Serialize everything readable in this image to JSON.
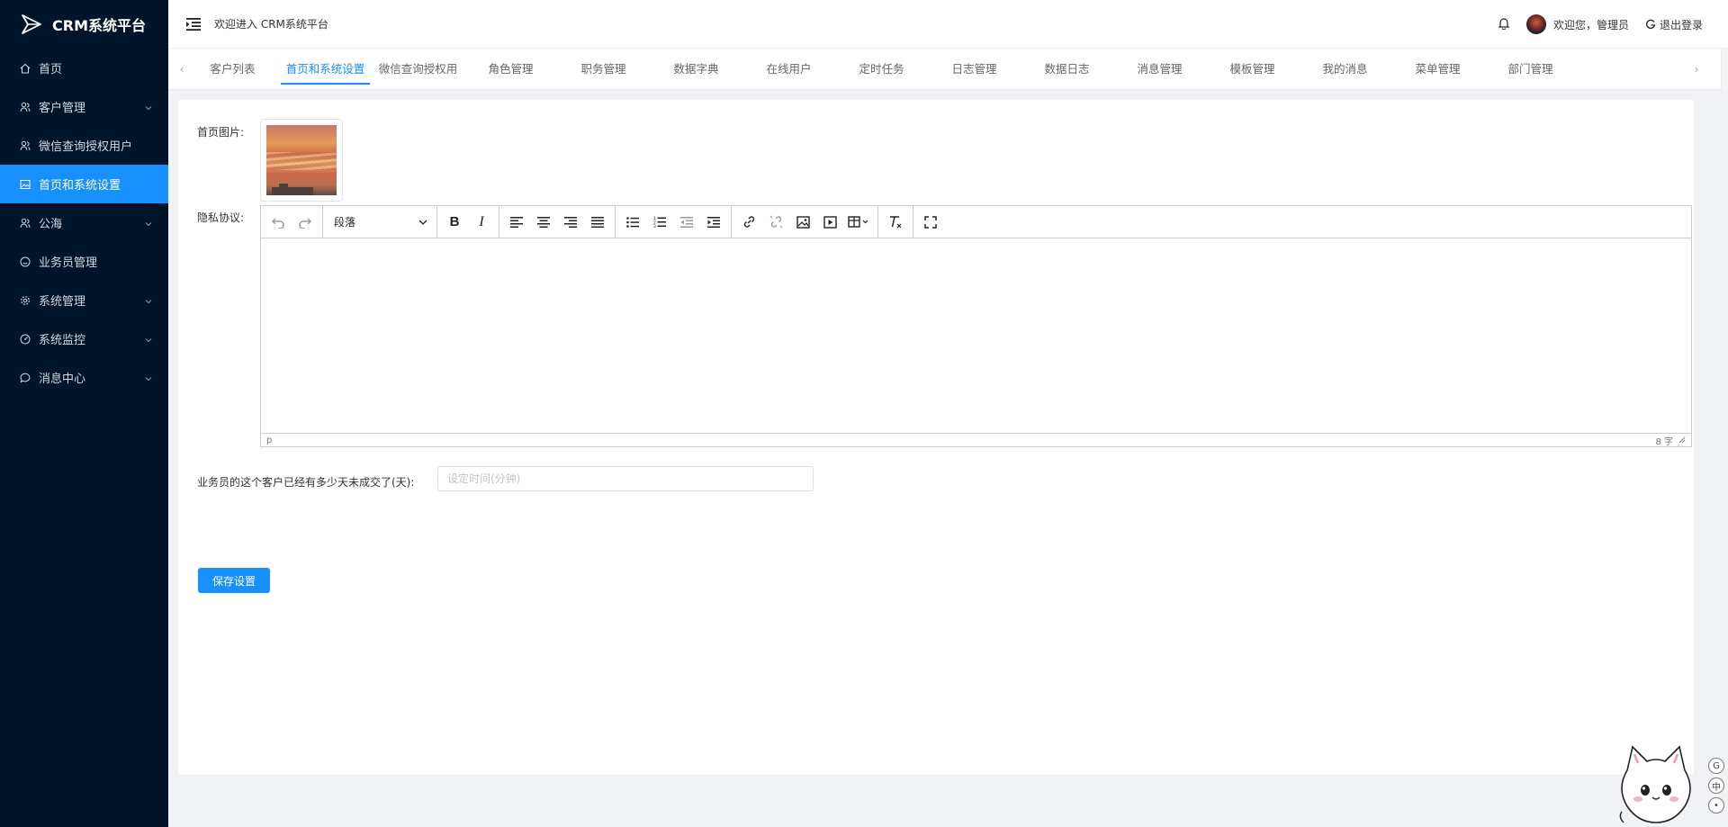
{
  "app": {
    "title": "CRM系统平台"
  },
  "sidebar": {
    "items": [
      {
        "label": "首页",
        "icon": "home-icon",
        "has_arrow": false,
        "active": false
      },
      {
        "label": "客户管理",
        "icon": "users-icon",
        "has_arrow": true,
        "active": false
      },
      {
        "label": "微信查询授权用户",
        "icon": "users-icon",
        "has_arrow": false,
        "active": false
      },
      {
        "label": "首页和系统设置",
        "icon": "image-icon",
        "has_arrow": false,
        "active": true
      },
      {
        "label": "公海",
        "icon": "users-icon",
        "has_arrow": true,
        "active": false
      },
      {
        "label": "业务员管理",
        "icon": "smile-icon",
        "has_arrow": false,
        "active": false
      },
      {
        "label": "系统管理",
        "icon": "gear-icon",
        "has_arrow": true,
        "active": false
      },
      {
        "label": "系统监控",
        "icon": "monitor-icon",
        "has_arrow": true,
        "active": false
      },
      {
        "label": "消息中心",
        "icon": "message-icon",
        "has_arrow": true,
        "active": false
      }
    ]
  },
  "header": {
    "welcome": "欢迎进入 CRM系统平台",
    "user_greeting": "欢迎您，管理员",
    "logout": "退出登录"
  },
  "tabs": [
    {
      "label": "客户列表",
      "active": false
    },
    {
      "label": "首页和系统设置",
      "active": true
    },
    {
      "label": "微信查询授权用户",
      "active": false
    },
    {
      "label": "角色管理",
      "active": false
    },
    {
      "label": "职务管理",
      "active": false
    },
    {
      "label": "数据字典",
      "active": false
    },
    {
      "label": "在线用户",
      "active": false
    },
    {
      "label": "定时任务",
      "active": false
    },
    {
      "label": "日志管理",
      "active": false
    },
    {
      "label": "数据日志",
      "active": false
    },
    {
      "label": "消息管理",
      "active": false
    },
    {
      "label": "模板管理",
      "active": false
    },
    {
      "label": "我的消息",
      "active": false
    },
    {
      "label": "菜单管理",
      "active": false
    },
    {
      "label": "部门管理",
      "active": false
    }
  ],
  "form": {
    "home_image_label": "首页图片:",
    "privacy_label": "隐私协议:",
    "editor": {
      "block_format": "段落",
      "status_path": "p",
      "word_count": "8 字"
    },
    "days_label": "业务员的这个客户已经有多少天未成交了(天):",
    "days_placeholder": "设定时间(分钟)",
    "days_value": "",
    "save_label": "保存设置"
  },
  "side_tools": [
    "G",
    "中",
    "•"
  ],
  "colors": {
    "sidebar_bg": "#001529",
    "accent": "#1890ff"
  }
}
